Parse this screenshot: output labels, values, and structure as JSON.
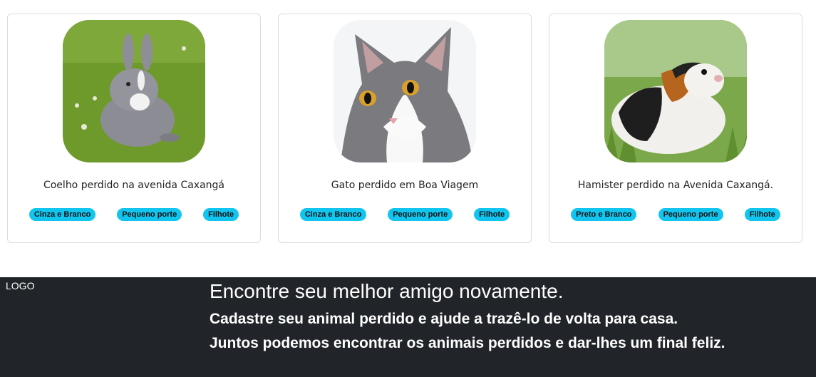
{
  "cards": [
    {
      "caption": "Coelho perdido na avenida Caxangá",
      "image": "rabbit-photo",
      "tags": [
        "Cinza e Branco",
        "Pequeno porte",
        "Filhote"
      ]
    },
    {
      "caption": "Gato perdido em Boa Viagem",
      "image": "cat-photo",
      "tags": [
        "Cinza e Branco",
        "Pequeno porte",
        "Filhote"
      ]
    },
    {
      "caption": "Hamister perdido na Avenida Caxangá.",
      "image": "guinea-pig-photo",
      "tags": [
        "Preto e Branco",
        "Pequeno porte",
        "Filhote"
      ]
    }
  ],
  "footer": {
    "logo": "LOGO",
    "headline": "Encontre seu melhor amigo novamente.",
    "line1": "Cadastre seu animal perdido e ajude a trazê-lo de volta para casa.",
    "line2": "Juntos podemos encontrar os animais perdidos e dar-lhes um final feliz."
  },
  "colors": {
    "tag": "#12c5ee",
    "footer_bg": "#212529"
  }
}
